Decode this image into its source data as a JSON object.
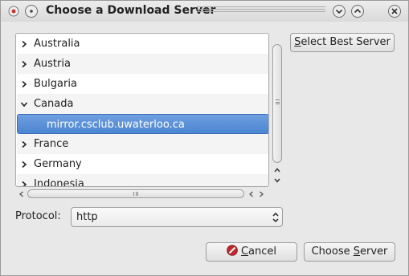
{
  "window": {
    "title": "Choose a Download Server"
  },
  "colors": {
    "selection": "#4c85d2",
    "cancel_icon": "#c0282a"
  },
  "server_list": {
    "rows": [
      {
        "label": "Australia",
        "expanded": false
      },
      {
        "label": "Austria",
        "expanded": false
      },
      {
        "label": "Bulgaria",
        "expanded": false
      },
      {
        "label": "Canada",
        "expanded": true
      },
      {
        "label": "mirror.csclub.uwaterloo.ca",
        "selected": true,
        "child": true
      },
      {
        "label": "France",
        "expanded": false
      },
      {
        "label": "Germany",
        "expanded": false
      },
      {
        "label": "Indonesia",
        "expanded": false
      }
    ]
  },
  "buttons": {
    "select_best": {
      "mnemonic": "S",
      "rest": "elect Best Server"
    },
    "cancel": {
      "mnemonic": "C",
      "rest": "ancel"
    },
    "choose": {
      "pre": "Choose ",
      "mnemonic": "S",
      "rest": "erver"
    }
  },
  "protocol": {
    "label": "Protocol:",
    "value": "http"
  },
  "icons": {
    "window_menu": "window-menu-icon",
    "minimize": "minimize-icon",
    "maximize": "maximize-icon",
    "close": "close-icon",
    "cancel": "cancel-icon"
  }
}
